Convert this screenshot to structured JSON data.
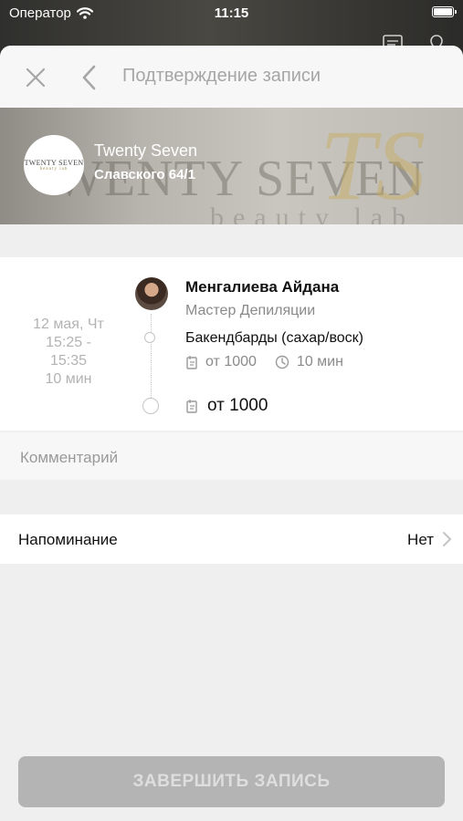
{
  "status_bar": {
    "carrier": "Оператор",
    "time": "11:15"
  },
  "nav": {
    "title": "Подтверждение записи"
  },
  "salon": {
    "name": "Twenty Seven",
    "address": "Славского 64/1",
    "logo_text": "TWENTY SEVEN",
    "banner_text": "WENTY SEVEN"
  },
  "booking": {
    "date": "12 мая, Чт",
    "time_start": "15:25 -",
    "time_end": "15:35",
    "duration_total": "10 мин",
    "master_name": "Менгалиева Айдана",
    "master_role": "Мастер Депиляции",
    "service_name": "Бакендбарды (сахар/воск)",
    "service_price": "от 1000",
    "service_duration": "10 мин",
    "total_price": "от 1000"
  },
  "comment": {
    "placeholder": "Комментарий",
    "value": ""
  },
  "reminder": {
    "label": "Напоминание",
    "value": "Нет"
  },
  "footer": {
    "finish_label": "ЗАВЕРШИТЬ ЗАПИСЬ"
  },
  "colors": {
    "button_disabled": "#b4b4b4",
    "muted_text": "#9a9a9a",
    "accent_gold": "#c8aa5a"
  }
}
